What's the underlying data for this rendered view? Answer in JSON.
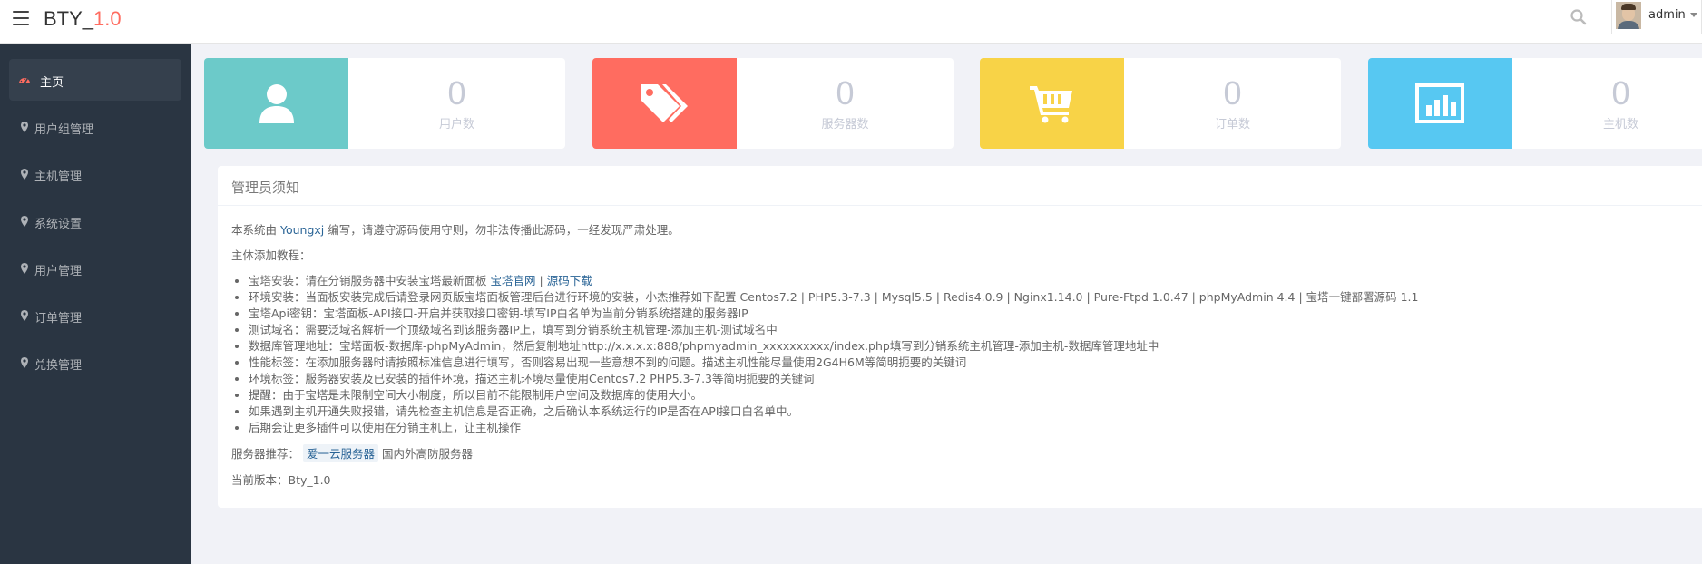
{
  "header": {
    "brand_name": "BTY_",
    "brand_version": "1.0",
    "user_name": "admin",
    "icons": {
      "menu": "hamburger-icon",
      "search": "search-icon",
      "caret": "caret-down-icon"
    }
  },
  "sidebar": {
    "items": [
      {
        "label": "主页",
        "icon": "dashboard-icon",
        "active": true
      },
      {
        "label": "用户组管理",
        "icon": "map-marker-icon"
      },
      {
        "label": "主机管理",
        "icon": "map-marker-icon"
      },
      {
        "label": "系统设置",
        "icon": "map-marker-icon"
      },
      {
        "label": "用户管理",
        "icon": "map-marker-icon"
      },
      {
        "label": "订单管理",
        "icon": "map-marker-icon"
      },
      {
        "label": "兑换管理",
        "icon": "map-marker-icon"
      }
    ]
  },
  "stats": [
    {
      "value": "0",
      "label": "用户数",
      "icon": "user-icon",
      "color": "#6ccac9"
    },
    {
      "value": "0",
      "label": "服务器数",
      "icon": "tags-icon",
      "color": "#ff6c60"
    },
    {
      "value": "0",
      "label": "订单数",
      "icon": "shopping-cart-icon",
      "color": "#f8d347"
    },
    {
      "value": "0",
      "label": "主机数",
      "icon": "bar-chart-icon",
      "color": "#57c8f2"
    }
  ],
  "notice": {
    "title": "管理员须知",
    "intro_prefix": "本系统由",
    "intro_author": "Youngxj",
    "intro_suffix": "编写，请遵守源码使用守则，勿非法传播此源码，一经发现严肃处理。",
    "tutorial_heading": "主体添加教程：",
    "bullet1_text": "宝塔安装：请在分销服务器中安装宝塔最新面板",
    "bullet1_link1": "宝塔官网",
    "bullet1_sep": "|",
    "bullet1_link2": "源码下载",
    "bullets": [
      "环境安装：当面板安装完成后请登录网页版宝塔面板管理后台进行环境的安装，小杰推荐如下配置 Centos7.2 | PHP5.3-7.3 | Mysql5.5 | Redis4.0.9 | Nginx1.14.0 | Pure-Ftpd 1.0.47 | phpMyAdmin 4.4 | 宝塔一键部署源码 1.1",
      "宝塔Api密钥：宝塔面板-API接口-开启并获取接口密钥-填写IP白名单为当前分销系统搭建的服务器IP",
      "测试域名：需要泛域名解析一个顶级域名到该服务器IP上，填写到分销系统主机管理-添加主机-测试域名中",
      "数据库管理地址：宝塔面板-数据库-phpMyAdmin，然后复制地址http://x.x.x.x:888/phpmyadmin_xxxxxxxxxx/index.php填写到分销系统主机管理-添加主机-数据库管理地址中",
      "性能标签：在添加服务器时请按照标准信息进行填写，否则容易出现一些意想不到的问题。描述主机性能尽量使用2G4H6M等简明扼要的关键词",
      "环境标签：服务器安装及已安装的插件环境，描述主机环境尽量使用Centos7.2 PHP5.3-7.3等简明扼要的关键词",
      "提醒：由于宝塔是未限制空间大小制度，所以目前不能限制用户空间及数据库的使用大小。",
      "如果遇到主机开通失败报错，请先检查主机信息是否正确，之后确认本系统运行的IP是否在API接口白名单中。",
      "后期会让更多插件可以使用在分销主机上，让主机操作"
    ],
    "server_prefix": "服务器推荐：",
    "server_link": "爱一云服务器",
    "server_suffix": "国内外高防服务器",
    "version_text": "当前版本：Bty_1.0"
  }
}
